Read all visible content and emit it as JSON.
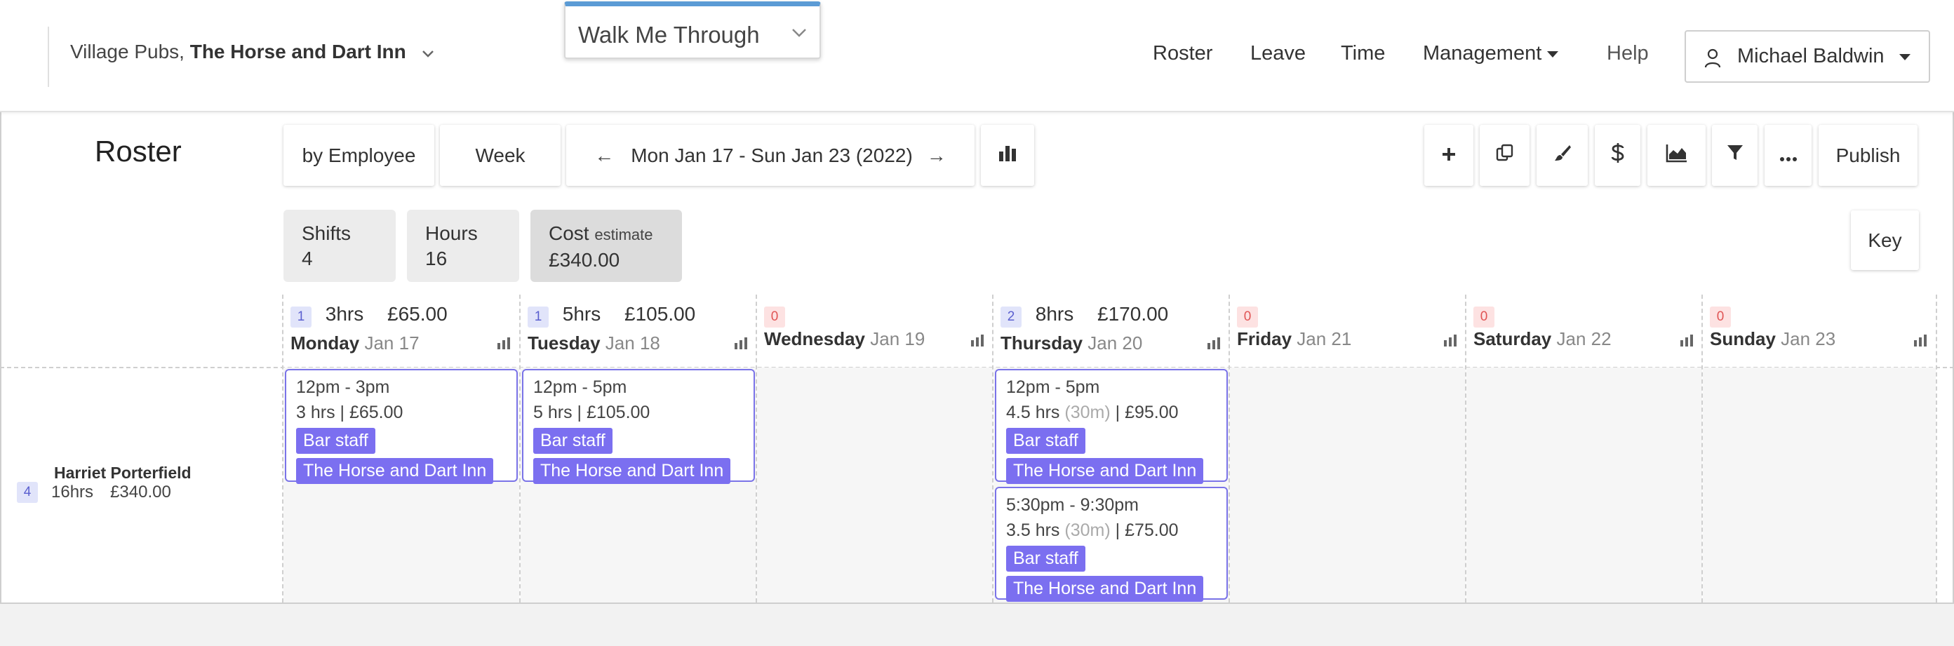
{
  "header": {
    "org": "Village Pubs,",
    "venue": "The Horse and Dart Inn",
    "walk_me": "Walk Me Through",
    "nav": [
      "Roster",
      "Leave",
      "Time",
      "Management",
      "Help"
    ],
    "user": "Michael Baldwin"
  },
  "toolbar": {
    "title": "Roster",
    "view_by": "by Employee",
    "period": "Week",
    "date_range": "Mon Jan 17 - Sun Jan 23 (2022)",
    "prev_arrow": "←",
    "next_arrow": "→",
    "publish": "Publish",
    "icons": [
      "add-icon",
      "copy-icon",
      "paint-brush-icon",
      "dollar-icon",
      "area-chart-icon",
      "filter-icon",
      "more-icon"
    ]
  },
  "summary": {
    "shifts_label": "Shifts",
    "shifts_value": "4",
    "hours_label": "Hours",
    "hours_value": "16",
    "cost_label": "Cost",
    "cost_note": "estimate",
    "cost_value": "£340.00",
    "key": "Key"
  },
  "days": [
    {
      "count": "1",
      "hours": "3hrs",
      "cost": "£65.00",
      "name": "Monday",
      "date": "Jan 17"
    },
    {
      "count": "1",
      "hours": "5hrs",
      "cost": "£105.00",
      "name": "Tuesday",
      "date": "Jan 18"
    },
    {
      "count": "0",
      "hours": "",
      "cost": "",
      "name": "Wednesday",
      "date": "Jan 19"
    },
    {
      "count": "2",
      "hours": "8hrs",
      "cost": "£170.00",
      "name": "Thursday",
      "date": "Jan 20"
    },
    {
      "count": "0",
      "hours": "",
      "cost": "",
      "name": "Friday",
      "date": "Jan 21"
    },
    {
      "count": "0",
      "hours": "",
      "cost": "",
      "name": "Saturday",
      "date": "Jan 22"
    },
    {
      "count": "0",
      "hours": "",
      "cost": "",
      "name": "Sunday",
      "date": "Jan 23"
    }
  ],
  "employee": {
    "name": "Harriet Porterfield",
    "count": "4",
    "hours": "16hrs",
    "cost": "£340.00"
  },
  "shifts": [
    {
      "time": "12pm - 3pm",
      "summary": "3 hrs | £65.00",
      "break": "",
      "rest": "",
      "role": "Bar staff",
      "location": "The Horse and Dart Inn"
    },
    {
      "time": "12pm - 5pm",
      "summary": "5 hrs | £105.00",
      "break": "",
      "rest": "",
      "role": "Bar staff",
      "location": "The Horse and Dart Inn"
    },
    {
      "time": "12pm - 5pm",
      "summary": "4.5 hrs",
      "break": "(30m)",
      "rest": "| £95.00",
      "role": "Bar staff",
      "location": "The Horse and Dart Inn"
    },
    {
      "time": "5:30pm - 9:30pm",
      "summary": "3.5 hrs",
      "break": "(30m)",
      "rest": "| £75.00",
      "role": "Bar staff",
      "location": "The Horse and Dart Inn"
    }
  ],
  "colors": {
    "accent": "#7b6ff0",
    "walk_me_bar": "#5b9bd5",
    "badge_blue": "#e1e4fa",
    "badge_red": "#fde2e2"
  }
}
